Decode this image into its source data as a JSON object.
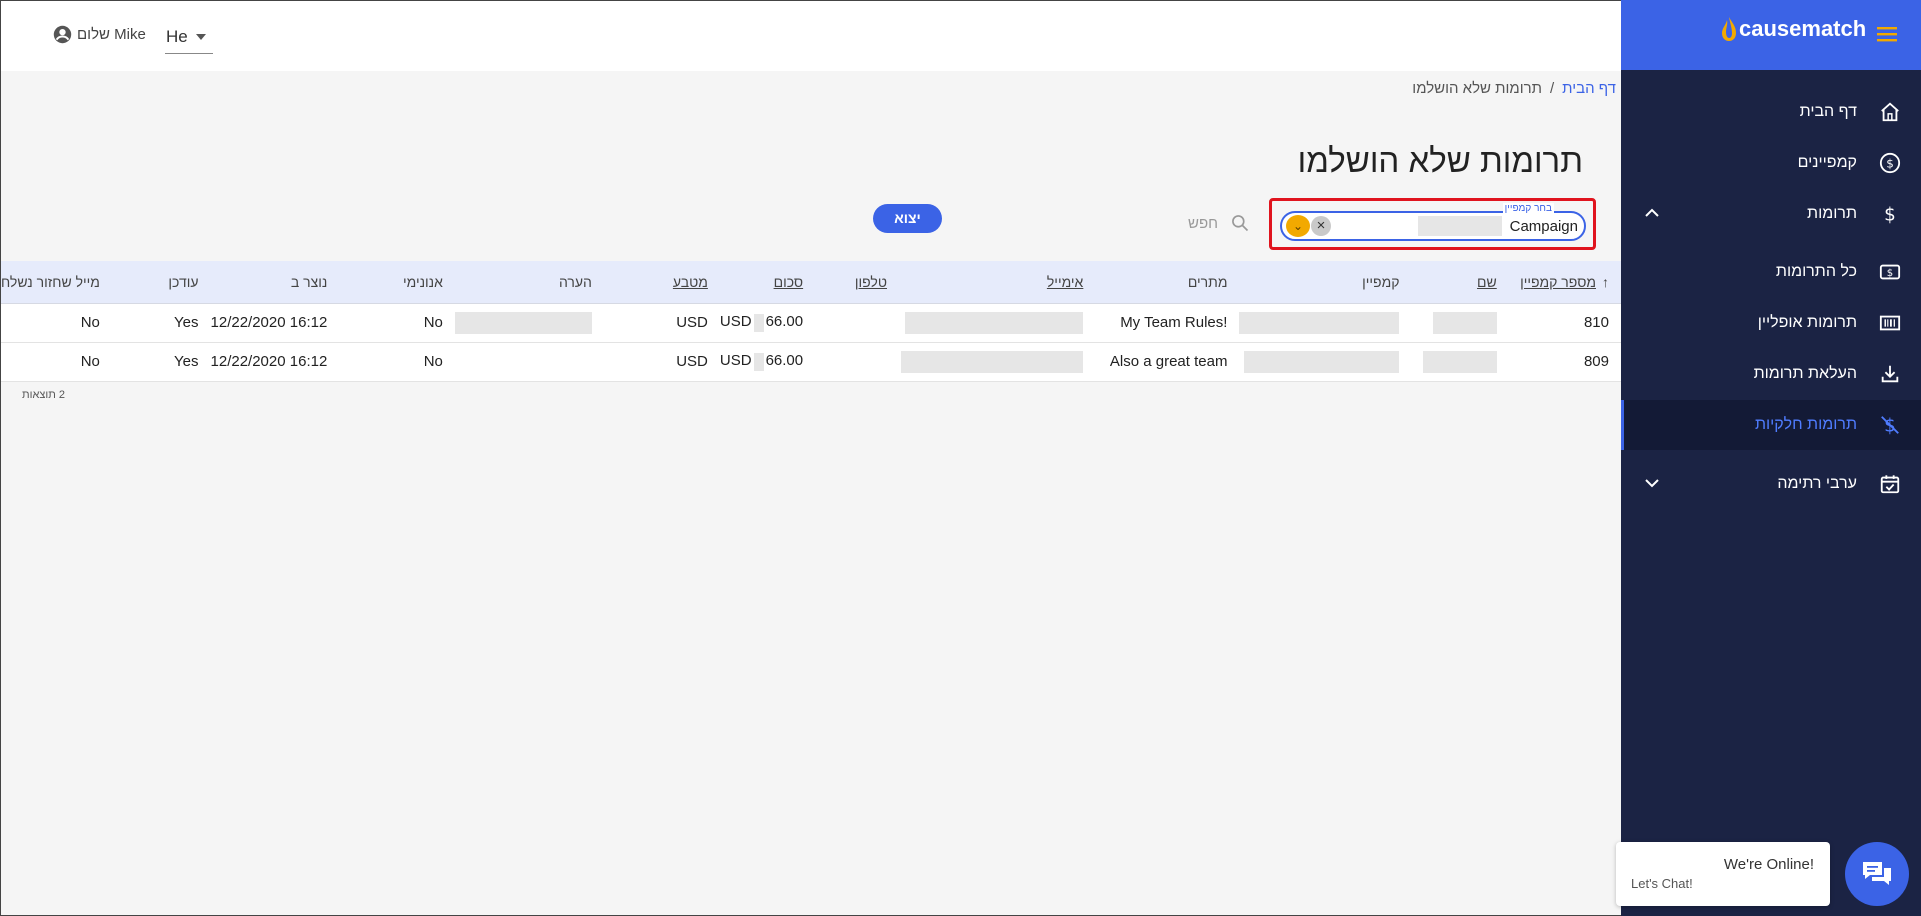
{
  "topbar": {
    "greeting": "שלום Mike",
    "language": "He"
  },
  "breadcrumb": {
    "home": "דף הבית",
    "separator": "/",
    "current": "תרומות שלא הושלמו"
  },
  "page": {
    "title": "תרומות שלא הושלמו"
  },
  "filters": {
    "campaign_label": "בחר קמפיין",
    "campaign_value": "Campaign",
    "search_placeholder": "חפש",
    "export_label": "יצוא"
  },
  "table": {
    "columns": [
      "מספר קמפיין",
      "שם",
      "קמפיין",
      "מתרים",
      "אימייל",
      "טלפון",
      "סכום",
      "מטבע",
      "הערה",
      "אנונימי",
      "נוצר ב",
      "עודכן",
      "מייל שחזור נשלח"
    ],
    "sort_indicator": "↑",
    "rows": [
      {
        "campaign_number": "810",
        "fundraiser": "My Team Rules!",
        "amount_currency": "USD",
        "amount": "66.00",
        "currency": "USD",
        "anonymous": "No",
        "created_at": "12/22/2020 16:12",
        "updated": "Yes",
        "recovery_sent": "No"
      },
      {
        "campaign_number": "809",
        "fundraiser": "Also a great team",
        "amount_currency": "USD",
        "amount": "66.00",
        "currency": "USD",
        "anonymous": "No",
        "created_at": "12/22/2020 16:12",
        "updated": "Yes",
        "recovery_sent": "No"
      }
    ],
    "results_count": "2 תוצאות"
  },
  "sidebar": {
    "logo": "causematch",
    "items": [
      {
        "label": "דף הבית",
        "icon": "home-icon"
      },
      {
        "label": "קמפיינים",
        "icon": "dollar-circle-icon"
      },
      {
        "label": "תרומות",
        "icon": "dollar-icon"
      },
      {
        "label": "כל התרומות",
        "icon": "money-icon"
      },
      {
        "label": "תרומות אופליין",
        "icon": "barcode-icon"
      },
      {
        "label": "העלאת תרומות",
        "icon": "download-icon"
      },
      {
        "label": "תרומות חלקיות",
        "icon": "dollar-off-icon"
      },
      {
        "label": "ערבי רתימה",
        "icon": "calendar-check-icon"
      }
    ],
    "active_color": "#4f7cff"
  },
  "chat": {
    "line1": "We're Online!",
    "line2": "Let's Chat!"
  },
  "colors": {
    "primary": "#3b63e6",
    "sidebar": "#1b2344",
    "highlight_border": "#e0141e",
    "dropdown_accent": "#f2a900"
  }
}
